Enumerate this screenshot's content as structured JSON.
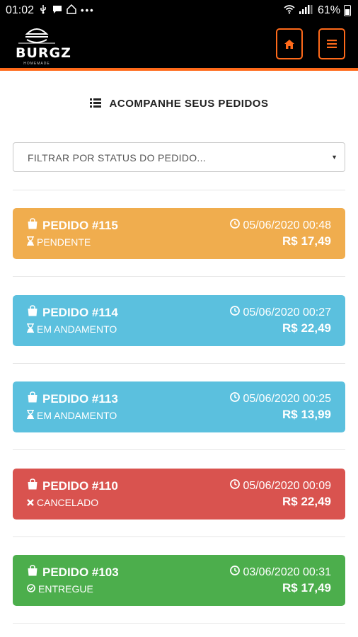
{
  "status_bar": {
    "time": "01:02",
    "battery": "61%"
  },
  "brand": {
    "name": "BURGZ",
    "tagline": "HOMEMADE"
  },
  "page": {
    "title": "ACOMPANHE SEUS PEDIDOS"
  },
  "filter": {
    "placeholder": "FILTRAR POR STATUS DO PEDIDO..."
  },
  "orders": [
    {
      "title": "PEDIDO #115",
      "status": "PENDENTE",
      "datetime": "05/06/2020 00:48",
      "total": "R$ 17,49",
      "color": "#f0ad4e",
      "status_icon": "hourglass-icon"
    },
    {
      "title": "PEDIDO #114",
      "status": "EM ANDAMENTO",
      "datetime": "05/06/2020 00:27",
      "total": "R$ 22,49",
      "color": "#5bc0de",
      "status_icon": "hourglass-icon"
    },
    {
      "title": "PEDIDO #113",
      "status": "EM ANDAMENTO",
      "datetime": "05/06/2020 00:25",
      "total": "R$ 13,99",
      "color": "#5bc0de",
      "status_icon": "hourglass-icon"
    },
    {
      "title": "PEDIDO #110",
      "status": "CANCELADO",
      "datetime": "05/06/2020 00:09",
      "total": "R$ 22,49",
      "color": "#d9534f",
      "status_icon": "times-icon"
    },
    {
      "title": "PEDIDO #103",
      "status": "ENTREGUE",
      "datetime": "03/06/2020 00:31",
      "total": "R$ 17,49",
      "color": "#4cae4c",
      "status_icon": "check-circle-icon"
    }
  ],
  "colors": {
    "accent": "#ff6a1a",
    "header_bg": "#000000"
  }
}
